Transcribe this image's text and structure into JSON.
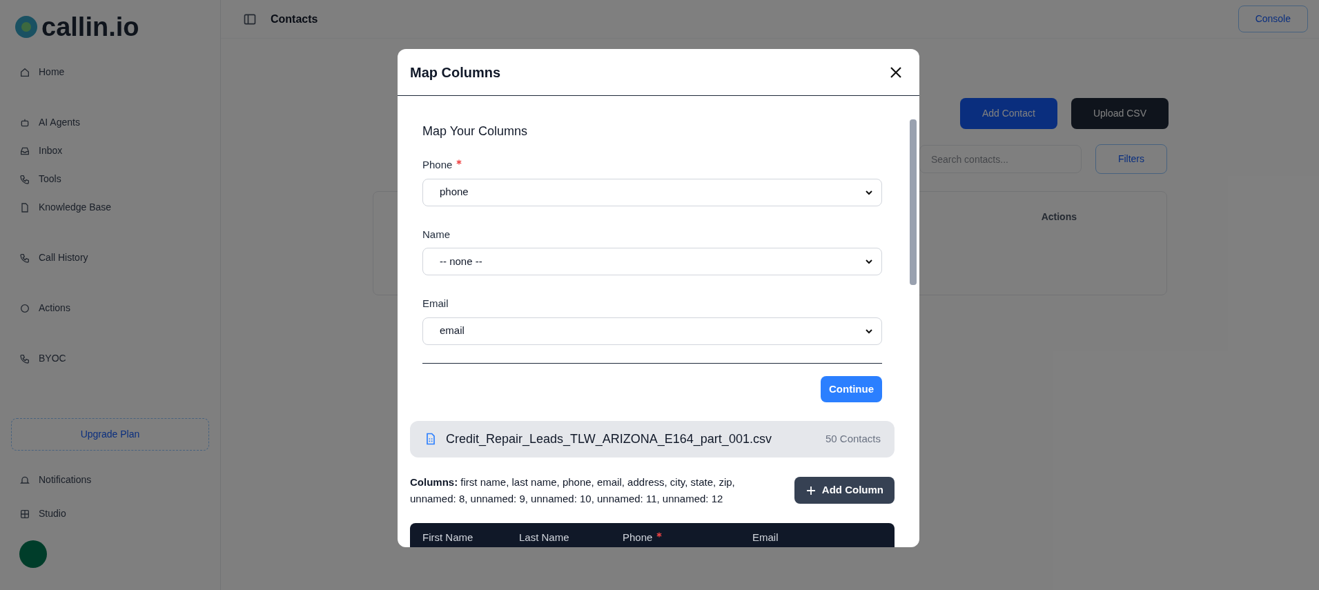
{
  "app": {
    "logo": "callin.io",
    "header_title": "Contacts",
    "console_button": "Console"
  },
  "sidebar": {
    "items": [
      {
        "label": "Home"
      },
      {
        "label": "AI Agents"
      },
      {
        "label": "Inbox"
      },
      {
        "label": "Tools"
      },
      {
        "label": "Knowledge Base"
      },
      {
        "label": "Call History"
      },
      {
        "label": "Actions"
      },
      {
        "label": "BYOC"
      }
    ],
    "upgrade_button": "Upgrade Plan",
    "bottom_items": [
      {
        "label": "Notifications"
      },
      {
        "label": "Studio"
      }
    ]
  },
  "page": {
    "buttons": [
      {
        "label": "Add Contact",
        "kind": "primary"
      },
      {
        "label": "Upload CSV",
        "kind": "dark"
      }
    ],
    "search": {
      "placeholder": "Search contacts..."
    },
    "filters_button": "Filters",
    "table_header": "Actions"
  },
  "modal": {
    "title": "Map Columns",
    "heading": "Map Your Columns",
    "fields": [
      {
        "label": "Phone",
        "required": true,
        "value": "phone"
      },
      {
        "label": "Name",
        "required": false,
        "value": "-- none --"
      },
      {
        "label": "Email",
        "required": false,
        "value": "email"
      }
    ],
    "continue_button": "Continue",
    "file": {
      "name": "Credit_Repair_Leads_TLW_ARIZONA_E164_part_001.csv",
      "count": "50 Contacts"
    },
    "columns_text": "**Columns:** first name, last name, phone, email, address, city, state, zip, unnamed: 8, unnamed: 9, unnamed: 10, unnamed: 11, unnamed: 12",
    "add_column_button": "Add Column",
    "table_columns": [
      {
        "label": "First Name",
        "required": false
      },
      {
        "label": "Last Name",
        "required": false
      },
      {
        "label": "Phone",
        "required": true
      },
      {
        "label": "Email",
        "required": false
      }
    ]
  }
}
